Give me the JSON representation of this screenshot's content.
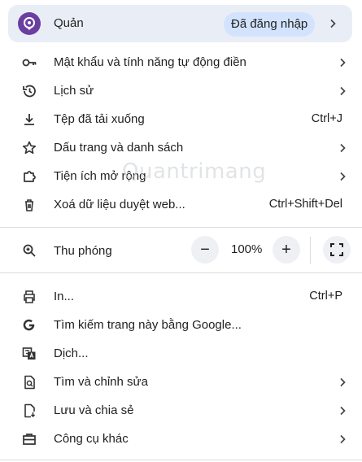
{
  "profile": {
    "name": "Quản",
    "status": "Đã đăng nhập"
  },
  "menu": {
    "passwords": "Mật khẩu và tính năng tự động điền",
    "history": "Lịch sử",
    "downloads": "Tệp đã tải xuống",
    "downloads_shortcut": "Ctrl+J",
    "bookmarks": "Dấu trang và danh sách",
    "extensions": "Tiện ích mở rộng",
    "clear_data": "Xoá dữ liệu duyệt web...",
    "clear_data_shortcut": "Ctrl+Shift+Del"
  },
  "zoom": {
    "label": "Thu phóng",
    "minus": "−",
    "value": "100%",
    "plus": "+"
  },
  "menu2": {
    "print": "In...",
    "print_shortcut": "Ctrl+P",
    "search_google": "Tìm kiếm trang này bằng Google...",
    "translate": "Dịch...",
    "find_edit": "Tìm và chỉnh sửa",
    "save_share": "Lưu và chia sẻ",
    "more_tools": "Công cụ khác"
  },
  "watermark": "Quantrimang"
}
